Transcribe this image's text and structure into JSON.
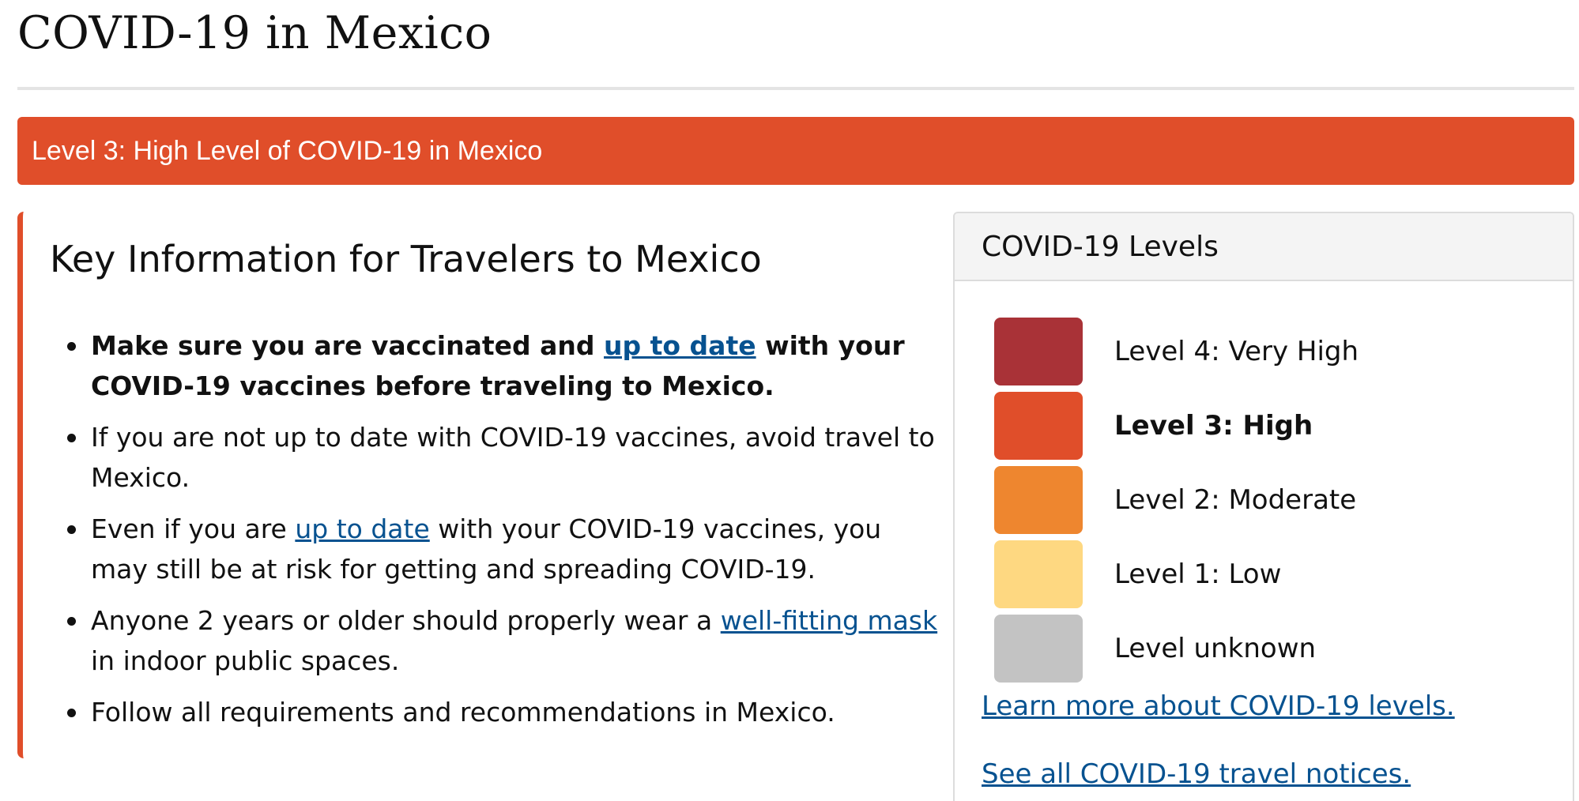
{
  "page": {
    "title": "COVID-19 in Mexico"
  },
  "banner": {
    "text": "Level 3: High Level of COVID-19 in Mexico",
    "color": "#e04e2a"
  },
  "key_info": {
    "heading": "Key Information for Travelers to Mexico",
    "items": [
      {
        "bold": true,
        "before": "Make sure you are vaccinated and ",
        "link": "up to date",
        "after": " with your COVID-19 vaccines before traveling to Mexico."
      },
      {
        "bold": false,
        "text": "If you are not up to date with COVID-19 vaccines, avoid travel to Mexico."
      },
      {
        "bold": false,
        "before": "Even if you are ",
        "link": "up to date",
        "after": " with your COVID-19 vaccines, you may still be at risk for getting and spreading COVID-19."
      },
      {
        "bold": false,
        "before": "Anyone 2 years or older should properly wear a ",
        "link": "well-fitting mask",
        "after": " in indoor public spaces."
      },
      {
        "bold": false,
        "text": "Follow all requirements and recommendations in Mexico."
      }
    ]
  },
  "levels_panel": {
    "header": "COVID-19 Levels",
    "levels": [
      {
        "label": "Level 4: Very High",
        "color": "#a93237",
        "current": false
      },
      {
        "label": "Level 3: High",
        "color": "#e04e2a",
        "current": true
      },
      {
        "label": "Level 2: Moderate",
        "color": "#ee862f",
        "current": false
      },
      {
        "label": "Level 1: Low",
        "color": "#fed881",
        "current": false
      },
      {
        "label": "Level unknown",
        "color": "#c3c3c3",
        "current": false
      }
    ],
    "learn_more_link": "Learn more about COVID-19 levels.",
    "all_notices_link": "See all COVID-19 travel notices."
  },
  "colors": {
    "link": "#075290",
    "rule": "#e4e4e4",
    "panel_border": "#dcdcdc",
    "panel_header_bg": "#f4f4f4"
  }
}
